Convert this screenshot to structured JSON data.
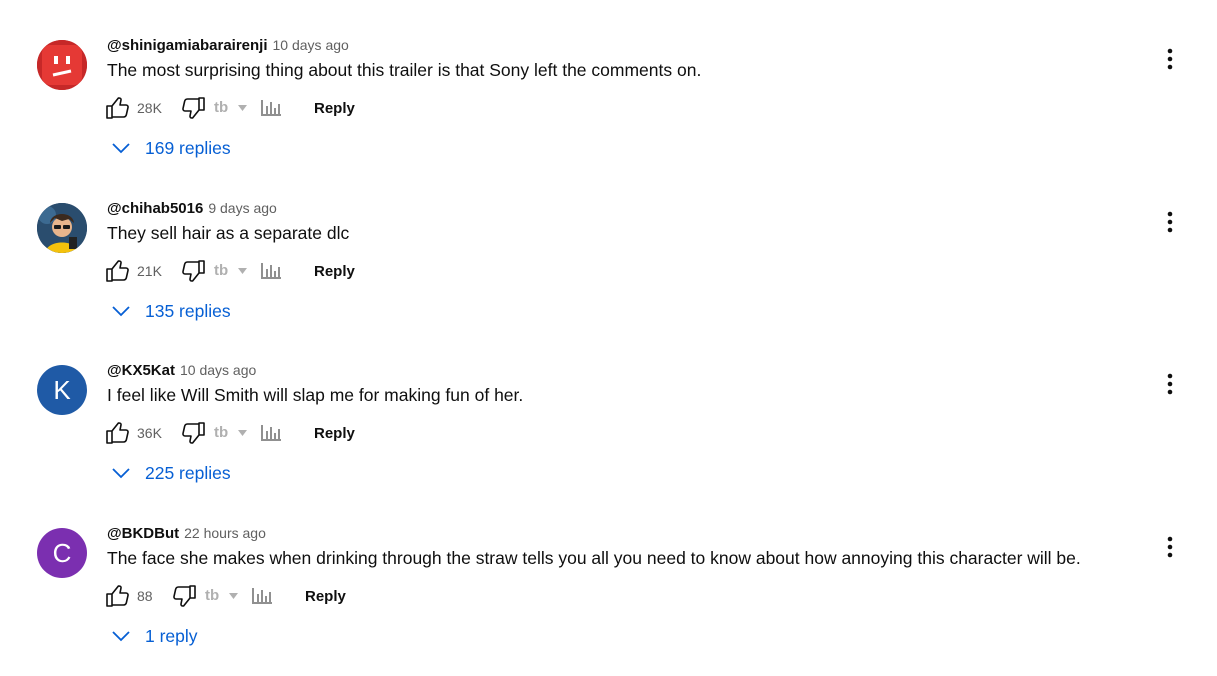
{
  "comments": [
    {
      "author": "@shinigamiabarairenji",
      "time": "10 days ago",
      "text": "The most surprising thing about this trailer is that Sony left the comments on.",
      "likes": "28K",
      "reply_label": "Reply",
      "replies_label": "169 replies",
      "avatar": {
        "type": "image",
        "icon": "red-face-avatar",
        "color": "#d32f2f"
      }
    },
    {
      "author": "@chihab5016",
      "time": "9 days ago",
      "text": "They sell hair as a separate dlc",
      "likes": "21K",
      "reply_label": "Reply",
      "replies_label": "135 replies",
      "avatar": {
        "type": "image",
        "icon": "cartoon-character-avatar",
        "color": "#2f5b8a"
      }
    },
    {
      "author": "@KX5Kat",
      "time": "10 days ago",
      "text": "I feel like Will Smith will slap me for making fun of her.",
      "likes": "36K",
      "reply_label": "Reply",
      "replies_label": "225 replies",
      "avatar": {
        "type": "letter",
        "letter": "K",
        "color": "#1f5aa6"
      }
    },
    {
      "author": "@BKDBut",
      "time": "22 hours ago",
      "text": "The face she makes when drinking through the straw tells you all you need to know about how annoying this character will be.",
      "likes": "88",
      "reply_label": "Reply",
      "replies_label": "1 reply",
      "avatar": {
        "type": "letter",
        "letter": "C",
        "color": "#7b2fb0"
      }
    }
  ],
  "colors": {
    "link": "#065fd4",
    "meta": "#606060",
    "text": "#0f0f0f"
  },
  "icons": [
    "thumbs-up-icon",
    "thumbs-down-icon",
    "tb-extension-icon",
    "bar-chart-icon",
    "chevron-down-icon",
    "more-vert-icon"
  ]
}
